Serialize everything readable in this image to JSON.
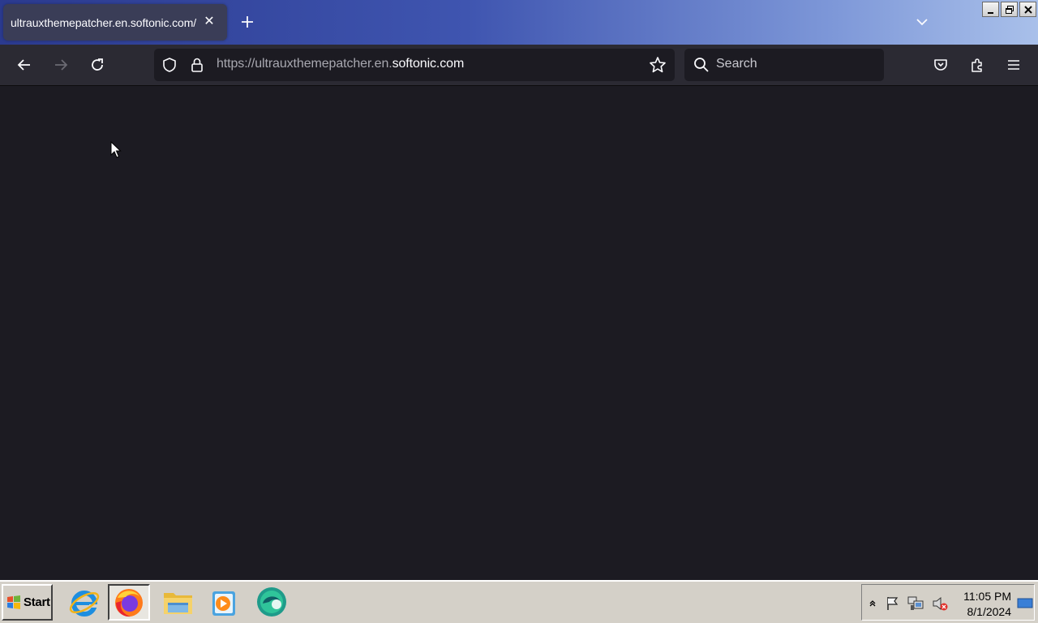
{
  "tab": {
    "title": "ultrauxthemepatcher.en.softonic.com/",
    "close_glyph": "✕"
  },
  "window_controls": [
    "minimize",
    "restore",
    "close"
  ],
  "url": {
    "prefix": "https://ultrauxthemepatcher.en.",
    "host": "softonic.com"
  },
  "search": {
    "placeholder": "Search"
  },
  "taskbar": {
    "start_label": "Start",
    "apps": [
      "internet-explorer",
      "firefox",
      "file-explorer",
      "media-player",
      "chat-app"
    ],
    "clock": {
      "time": "11:05 PM",
      "date": "8/1/2024"
    }
  },
  "colors": {
    "accent": "#3f55b0",
    "content_bg": "#1c1b22",
    "toolbar_bg": "#2b2a33"
  }
}
